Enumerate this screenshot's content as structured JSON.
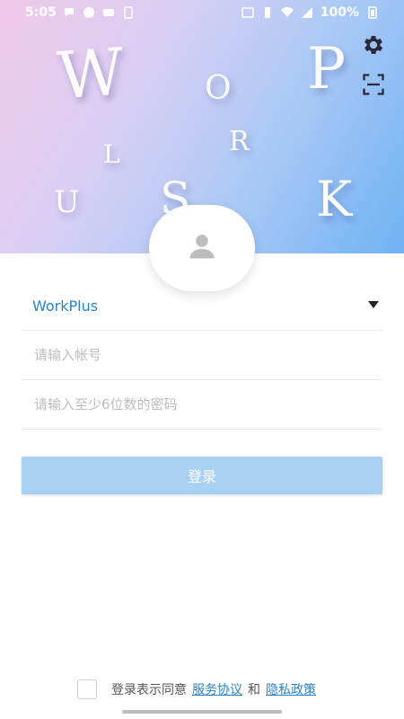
{
  "status_bar": {
    "time": "5:05",
    "battery": "100%",
    "network": "4G"
  },
  "hero": {
    "letters": [
      "W",
      "O",
      "P",
      "R",
      "L",
      "U",
      "S",
      "K"
    ]
  },
  "form": {
    "org_value": "WorkPlus",
    "account_placeholder": "请输入帐号",
    "password_placeholder": "请输入至少6位数的密码",
    "login_label": "登录"
  },
  "agreement": {
    "prefix": "登录表示同意",
    "service_link": "服务协议",
    "and": "和",
    "privacy_link": "隐私政策"
  },
  "colors": {
    "accent": "#2b84c7",
    "button": "#a9d1f3"
  }
}
